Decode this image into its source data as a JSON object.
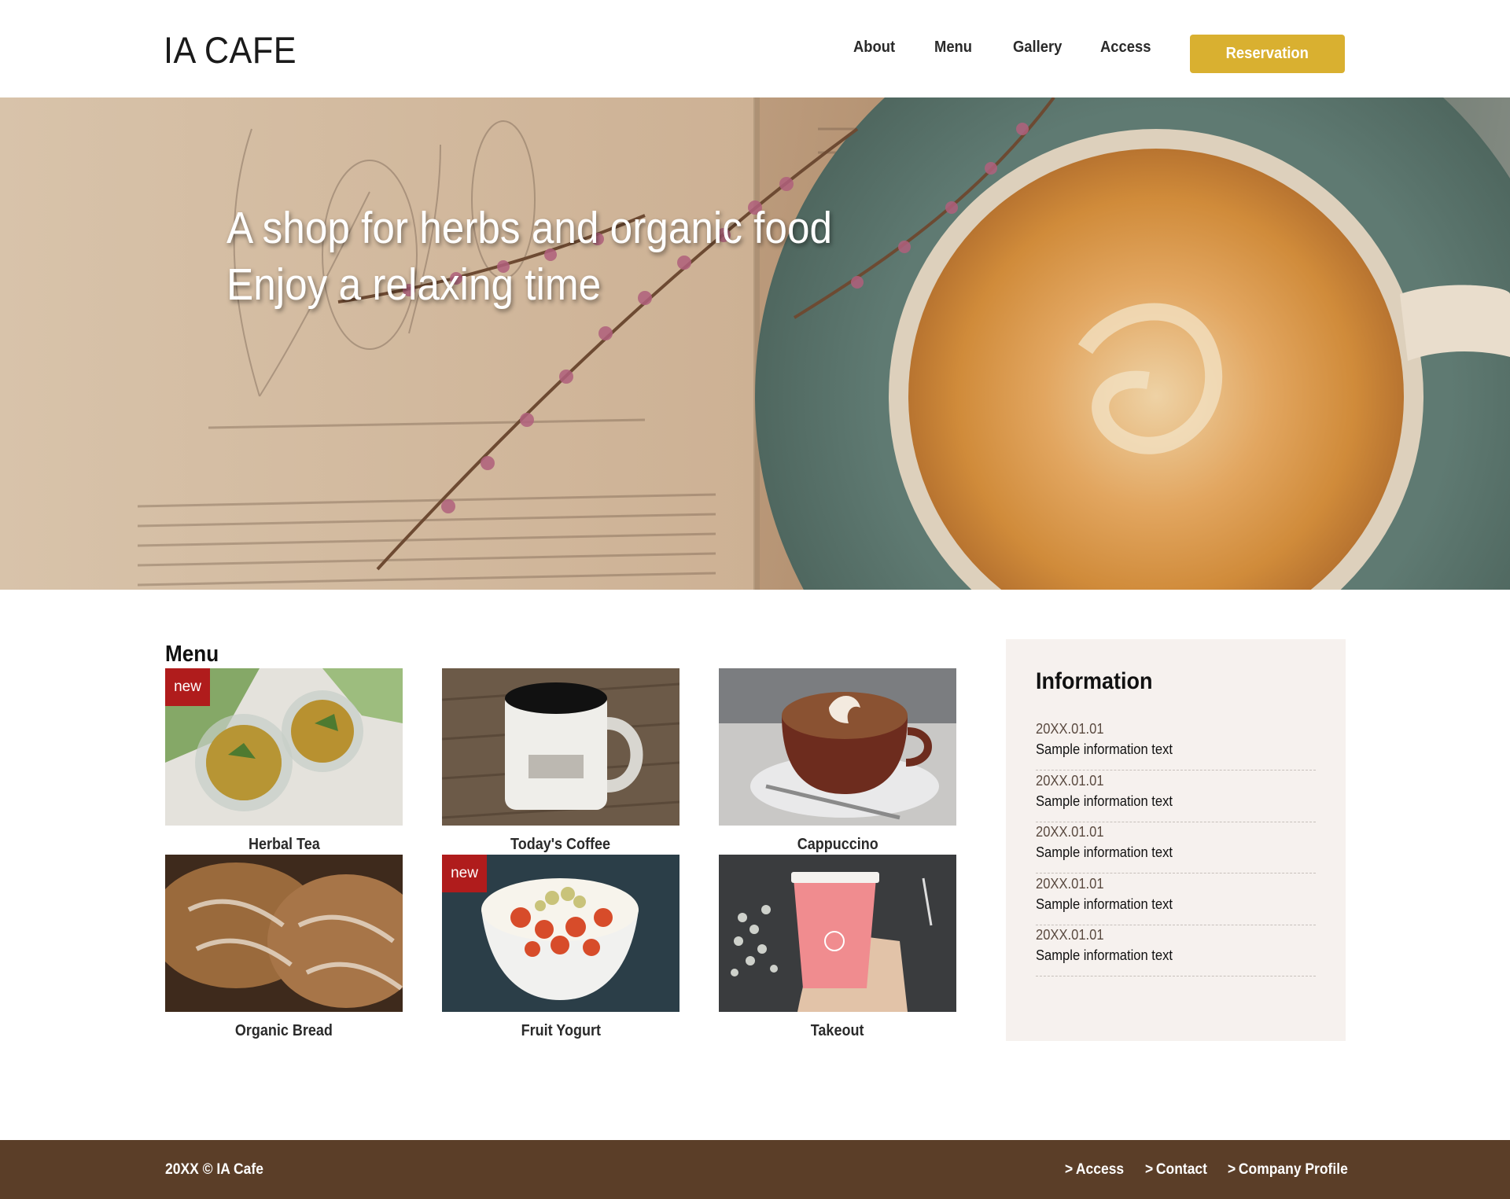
{
  "header": {
    "logo": "IA CAFE",
    "nav": [
      {
        "label": "About"
      },
      {
        "label": "Menu"
      },
      {
        "label": "Gallery"
      },
      {
        "label": "Access"
      }
    ],
    "reservation_label": "Reservation",
    "accent_color": "#d9b030"
  },
  "hero": {
    "line1": "A shop for herbs and organic food",
    "line2": "Enjoy a relaxing time"
  },
  "menu": {
    "title": "Menu",
    "badge_label": "new",
    "items": [
      {
        "name": "Herbal Tea",
        "is_new": true
      },
      {
        "name": "Today's Coffee",
        "is_new": false
      },
      {
        "name": "Cappuccino",
        "is_new": false
      },
      {
        "name": "Organic Bread",
        "is_new": false
      },
      {
        "name": "Fruit Yogurt",
        "is_new": true
      },
      {
        "name": "Takeout",
        "is_new": false
      }
    ]
  },
  "information": {
    "title": "Information",
    "items": [
      {
        "date": "20XX.01.01",
        "text": "Sample information text"
      },
      {
        "date": "20XX.01.01",
        "text": "Sample information text"
      },
      {
        "date": "20XX.01.01",
        "text": "Sample information text"
      },
      {
        "date": "20XX.01.01",
        "text": "Sample information text"
      },
      {
        "date": "20XX.01.01",
        "text": "Sample information text"
      }
    ]
  },
  "footer": {
    "copyright": "20XX © IA Cafe",
    "link_marker": ">",
    "links": [
      {
        "label": "Access"
      },
      {
        "label": "Contact"
      },
      {
        "label": "Company Profile"
      }
    ],
    "background_color": "#5b3e28"
  }
}
